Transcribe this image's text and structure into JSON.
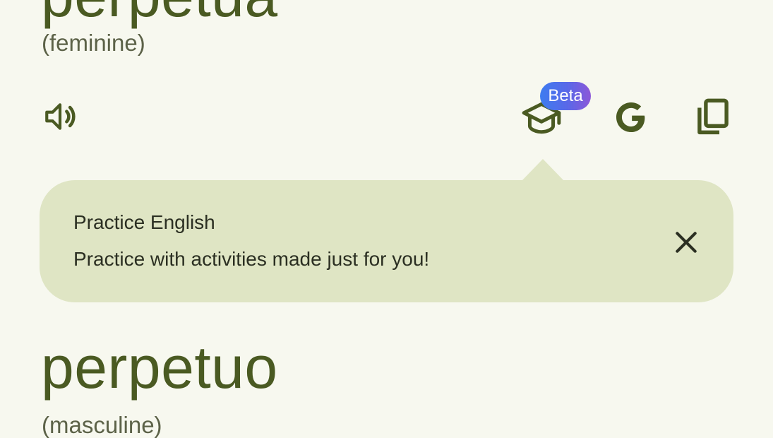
{
  "entries": [
    {
      "word": "perpetua",
      "gender": "(feminine)"
    },
    {
      "word": "perpetuo",
      "gender": "(masculine)"
    }
  ],
  "actions": {
    "speaker_icon": "speaker-icon",
    "practice_icon": "graduation-cap-icon",
    "google_icon": "google-g-icon",
    "copy_icon": "copy-icon",
    "beta_label": "Beta"
  },
  "tooltip": {
    "title": "Practice English",
    "body": "Practice with activities made just for you!",
    "close_icon": "close-icon"
  },
  "colors": {
    "background": "#f7f8ef",
    "word_text": "#4a5a22",
    "icon": "#4a5a22",
    "tooltip_background": "#dfe5c4",
    "beta_gradient_start": "#3d7cf0",
    "beta_gradient_end": "#8c58d8"
  }
}
